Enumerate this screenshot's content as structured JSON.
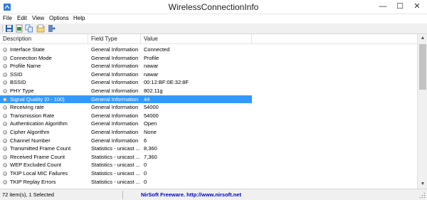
{
  "window": {
    "title": "WirelessConnectionInfo",
    "min_glyph": "—",
    "max_glyph": "☐",
    "close_glyph": "✕"
  },
  "menu": [
    "File",
    "Edit",
    "View",
    "Options",
    "Help"
  ],
  "toolbar": {
    "icons": [
      "save-icon",
      "html-report-icon",
      "copy-icon",
      "properties-icon",
      "exit-icon"
    ]
  },
  "columns": {
    "description": "Description",
    "field_type": "Field Type",
    "value": "Value"
  },
  "rows": [
    {
      "description": "Interface State",
      "field_type": "General Information",
      "value": "Connected"
    },
    {
      "description": "Connection Mode",
      "field_type": "General Information",
      "value": "Profile"
    },
    {
      "description": "Profile Name",
      "field_type": "General Information",
      "value": "nawar"
    },
    {
      "description": "SSID",
      "field_type": "General Information",
      "value": "nawar"
    },
    {
      "description": "BSSID",
      "field_type": "General Information",
      "value": "00:12:BF:0E:32:8F"
    },
    {
      "description": "PHY Type",
      "field_type": "General Information",
      "value": "802.11g"
    },
    {
      "description": "Signal Quality (0 - 100)",
      "field_type": "General Information",
      "value": "44",
      "selected": true
    },
    {
      "description": "Receiving rate",
      "field_type": "General Information",
      "value": "54000"
    },
    {
      "description": "Transmission Rate",
      "field_type": "General Information",
      "value": "54000"
    },
    {
      "description": "Authentication Algorithm",
      "field_type": "General Information",
      "value": "Open"
    },
    {
      "description": "Cipher Algorithm",
      "field_type": "General Information",
      "value": "None"
    },
    {
      "description": "Channel Number",
      "field_type": "General Information",
      "value": "6"
    },
    {
      "description": "Transmitted Frame Count",
      "field_type": "Statistics - unicast ...",
      "value": "8,360"
    },
    {
      "description": "Received Frame Count",
      "field_type": "Statistics - unicast ...",
      "value": "7,360"
    },
    {
      "description": "WEP Excluded Count",
      "field_type": "Statistics - unicast ...",
      "value": "0"
    },
    {
      "description": "TKIP Local MIC Failures",
      "field_type": "Statistics - unicast ...",
      "value": "0"
    },
    {
      "description": "TKIP Replay Errors",
      "field_type": "Statistics - unicast ...",
      "value": "0"
    }
  ],
  "status": {
    "selection": "72 item(s), 1 Selected",
    "credit": "NirSoft Freeware.  http://www.nirsoft.net"
  },
  "colors": {
    "selection": "#3399ff",
    "credit_link": "#0000cc"
  }
}
